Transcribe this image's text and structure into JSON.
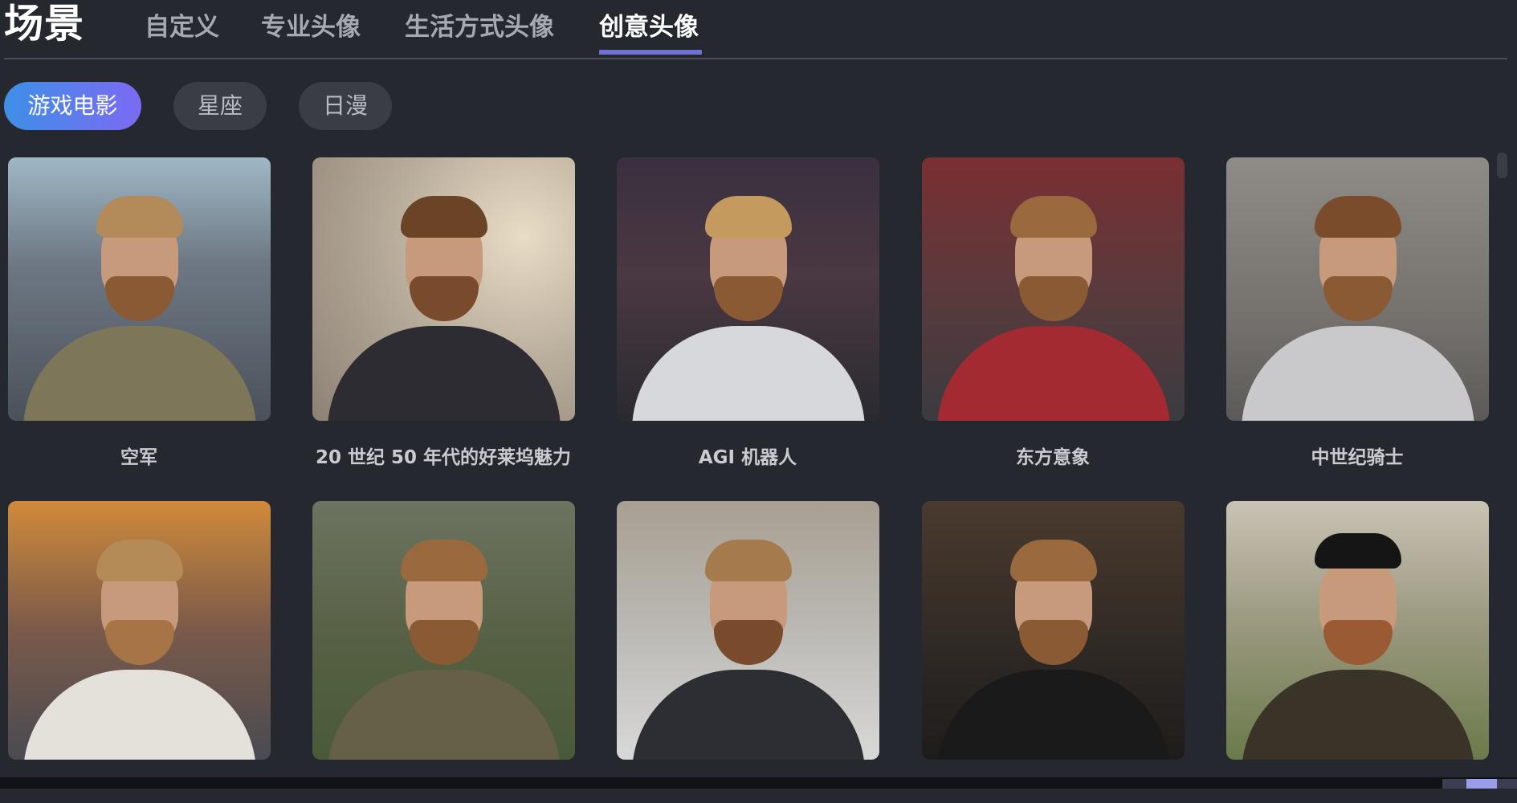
{
  "header": {
    "title": "场景",
    "tabs": [
      {
        "label": "自定义",
        "active": false
      },
      {
        "label": "专业头像",
        "active": false
      },
      {
        "label": "生活方式头像",
        "active": false
      },
      {
        "label": "创意头像",
        "active": true
      }
    ]
  },
  "filters": [
    {
      "label": "游戏电影",
      "active": true
    },
    {
      "label": "星座",
      "active": false
    },
    {
      "label": "日漫",
      "active": false
    }
  ],
  "cards": [
    {
      "caption": "空军",
      "theme": "navy-ship-soldier"
    },
    {
      "caption": "20 世纪 50 年代的好莱坞魅力",
      "theme": "hollywood-suit"
    },
    {
      "caption": "AGI 机器人",
      "theme": "neon-robot"
    },
    {
      "caption": "东方意象",
      "theme": "red-temple"
    },
    {
      "caption": "中世纪骑士",
      "theme": "castle-knight"
    },
    {
      "caption": "",
      "theme": "dragon-fire-warrior"
    },
    {
      "caption": "",
      "theme": "forest-soldier"
    },
    {
      "caption": "",
      "theme": "car-driver"
    },
    {
      "caption": "",
      "theme": "dark-cloak-skull"
    },
    {
      "caption": "",
      "theme": "castle-noble"
    }
  ],
  "colors": {
    "background": "#25282e",
    "accent": "#6e72d6",
    "chip_gradient_start": "#3e8fe6",
    "chip_gradient_end": "#7c6af3"
  }
}
